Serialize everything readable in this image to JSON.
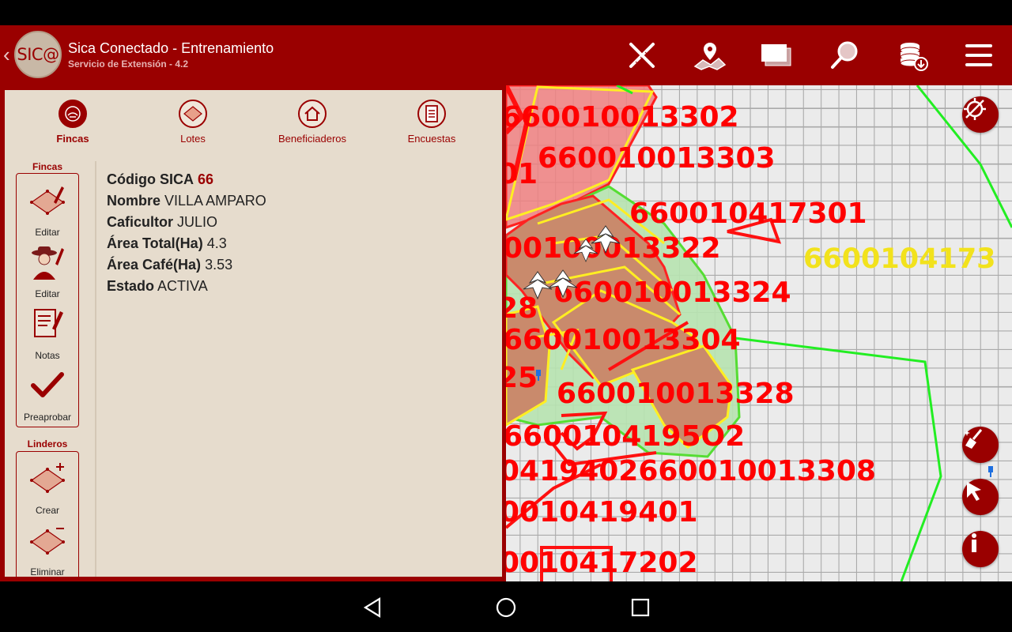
{
  "app": {
    "title": "Sica Conectado - Entrenamiento",
    "subtitle": "Servicio de Extensión - 4.2",
    "logo_text": "SIC@"
  },
  "toolbar": {
    "icons": [
      "measure-icon",
      "map-location-icon",
      "layers-icon",
      "search-icon",
      "database-download-icon",
      "menu-icon"
    ]
  },
  "tabs": [
    {
      "label": "Fincas",
      "icon": "farm-icon",
      "active": true
    },
    {
      "label": "Lotes",
      "icon": "lot-diamond-icon",
      "active": false
    },
    {
      "label": "Beneficiaderos",
      "icon": "house-icon",
      "active": false
    },
    {
      "label": "Encuestas",
      "icon": "survey-document-icon",
      "active": false
    }
  ],
  "fincas_section": {
    "label": "Fincas",
    "tools": [
      {
        "label": "Editar",
        "icon": "edit-polygon-icon"
      },
      {
        "label": "Editar",
        "icon": "edit-farmer-icon"
      },
      {
        "label": "Notas",
        "icon": "notes-icon"
      },
      {
        "label": "Preaprobar",
        "icon": "check-icon"
      }
    ]
  },
  "linderos_section": {
    "label": "Linderos",
    "tools": [
      {
        "label": "Crear",
        "icon": "create-boundary-icon"
      },
      {
        "label": "Eliminar",
        "icon": "delete-boundary-icon"
      }
    ]
  },
  "farm_info": {
    "codigo_label": "Código SICA",
    "codigo_value": "66",
    "nombre_label": "Nombre",
    "nombre_value": "VILLA AMPARO",
    "caficultor_label": "Caficultor",
    "caficultor_value": "JULIO",
    "area_total_label": "Área Total(Ha)",
    "area_total_value": "4.3",
    "area_cafe_label": "Área Café(Ha)",
    "area_cafe_value": "3.53",
    "estado_label": "Estado",
    "estado_value": "ACTIVA"
  },
  "map": {
    "labels": [
      "660010013302",
      "01",
      "660010013303",
      "660010417301",
      "6600104173",
      "00100013322",
      "28",
      "660010013324",
      "660010013304",
      "25",
      "660010013328",
      "6600104195O2",
      "0419402660010013308",
      "0010419401",
      "0010417202"
    ],
    "buttons": [
      "gps-off-icon",
      "clear-brush-icon",
      "select-pointer-icon",
      "info-icon"
    ],
    "colors": {
      "parcel_red": "#ff0000",
      "label_yellow": "#f2e21c",
      "boundary_green": "#22ee22",
      "grid": "#aaaaaa"
    }
  },
  "nav": {
    "buttons": [
      "back-icon",
      "home-icon",
      "recents-icon"
    ]
  }
}
